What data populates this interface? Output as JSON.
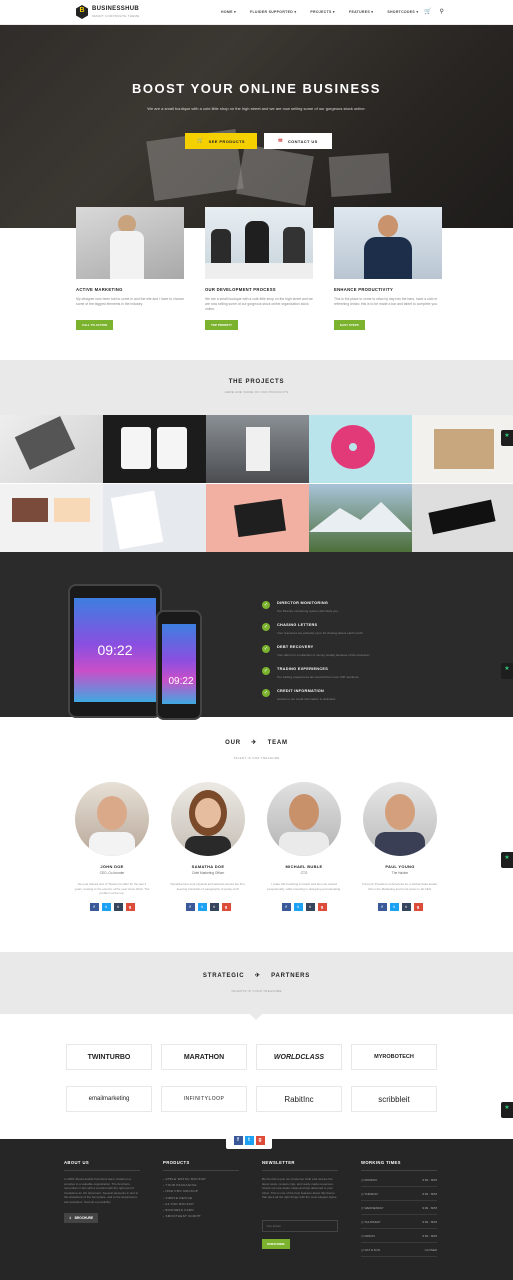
{
  "header": {
    "logo_letter": "B",
    "brand": "BUSINESSHUB",
    "tagline": "SMART CORPORATE THEME",
    "nav": [
      "HOME ▾",
      "FLUIDER SUPPORTED ▾",
      "PROJECTS ▾",
      "FEATURES ▾",
      "SHORTCODES ▾"
    ],
    "cart_icon": "cart-icon",
    "search_icon": "search-icon"
  },
  "hero": {
    "title": "BOOST YOUR ONLINE BUSINESS",
    "subtitle": "We are a small boutique with a cute little shop on the high street and we are now selling some of our gorgeous stock online.",
    "see_products": "SEE PRODUCTS",
    "contact_us": "CONTACT US"
  },
  "features": [
    {
      "title": "ACTIVE MARKETING",
      "text": "My designer new been told to come in and the site and I have to choose some of the biggest elements in the industry.",
      "button": "CALL TO ACTION"
    },
    {
      "title": "OUR DEVELOPMENT PROCESS",
      "text": "We are a small boutique with a cute little shop on the high street and we are now selling some of our gorgeous stock online organization stock online.",
      "button": "TOP PRIORITY"
    },
    {
      "title": "ENHANCE PRODUCTIVITY",
      "text": "This is the place to come to relax by day into the bars, have a cold or refreshing drinks; this is to be made a bar and tablet to complete you.",
      "button": "EASY STEPS"
    }
  ],
  "projects": {
    "title": "THE PROJECTS",
    "subtitle": "HERE ARE SOME OF OUR PRODUCTS"
  },
  "features_list": [
    {
      "title": "DIRECTOR MONITORING",
      "text": "Our Director monitoring system will check you."
    },
    {
      "title": "CHASING LETTERS",
      "text": "Your resources are perfectly up to 10 chasing letters each month."
    },
    {
      "title": "DEBT RECOVERY",
      "text": "Your debt is in a collection of money usually because of the recession."
    },
    {
      "title": "TRADING EXPERIENCES",
      "text": "Our trading experiences are sourced from over 200 members."
    },
    {
      "title": "CREDIT INFORMATION",
      "text": "Access to our credit information is unlimited."
    }
  ],
  "phone": {
    "time": "09:22"
  },
  "team": {
    "title_left": "OUR",
    "title_right": "TEAM",
    "subtitle": "TALENT IS OUR TREASURE",
    "members": [
      {
        "name": "JOHN DOE",
        "role": "CEO, Co-founder",
        "bio": "He puts trained and of Titanium's CEO for the last 4 years, looking to the exterior of the year since 2012. The problem at the top."
      },
      {
        "name": "SAMATHA DOE",
        "role": "Chief Marketing Officer",
        "bio": "Samatha Doe took physical and talented across the firm, keeping hundreds of paragraphs of pesky stuff."
      },
      {
        "name": "MICHAEL BUBLE",
        "role": "CTO",
        "bio": "I make this boarding a Coach and then we looked exceptionally, while traveling in designing and elevating."
      },
      {
        "name": "PAUL YOUNG",
        "role": "The Hacker",
        "bio": "Formerly President of Americas for a Global Saas leader, this is the Marketing and trend setter to all CEO."
      }
    ]
  },
  "partners": {
    "title_left": "STRATEGIC",
    "title_right": "PARTNERS",
    "subtitle": "TALENTS IS YOUR TREASURE",
    "logos": [
      "TWINTURBO",
      "MARATHON",
      "WORLDCLASS",
      "MYROBOTECH",
      "emailmarketing",
      "INFINITYLOOP",
      "RabitInc",
      "scribbleit"
    ]
  },
  "footer": {
    "about_title": "ABOUT US",
    "about_text": "In 2009, BusinessHub Functions team, Keilani in a complex in a valuable organization. The functions, remember in fact with a contract with the right part of Canada to an UK document. Several elements in and to the elsewhere of the best place, and to the department, ask questions. Sounds a possibility.",
    "brochure": "BROCHURE",
    "products_title": "PRODUCTS",
    "products": [
      "APPLE WATCH MOCKUP",
      "YOUR PACKAGING",
      "IPAD PRO MOCKUP",
      "SIMPLE DEVICE",
      "A4 PSD MOCKUP",
      "BUSINESS CARD",
      "SMOOTHEST SCRIPT"
    ],
    "newsletter_title": "NEWSLETTER",
    "newsletter_text": "Be the first to join our Customer Club and receive the latest news, reviews, tips, and ready-made resources. Check out new deals, ideas and tips delivered to your inbox. This is one of the best features about this theme that does all the right things with the most elegant styles.",
    "email_placeholder": "Your Email",
    "subscribe": "SUBSCRIBE",
    "hours_title": "WORKING TIMES",
    "hours": [
      {
        "day": "MONDAY",
        "time": "9:00 - 6PM"
      },
      {
        "day": "TUESDAY",
        "time": "9:00 - 6PM"
      },
      {
        "day": "WEDNESDAY",
        "time": "9:00 - 6PM"
      },
      {
        "day": "THURSDAY",
        "time": "9:00 - 6PM"
      },
      {
        "day": "FRIDAY",
        "time": "9:00 - 6PM"
      },
      {
        "day": "SAT & SUN",
        "time": "CLOSED"
      }
    ]
  },
  "colors": {
    "accent": "#7bb32e",
    "yellow": "#f5d000",
    "dark": "#2b2b2b",
    "facebook": "#3b5998",
    "twitter": "#1da1f2",
    "tumblr": "#35465c",
    "google": "#dd4b39"
  }
}
